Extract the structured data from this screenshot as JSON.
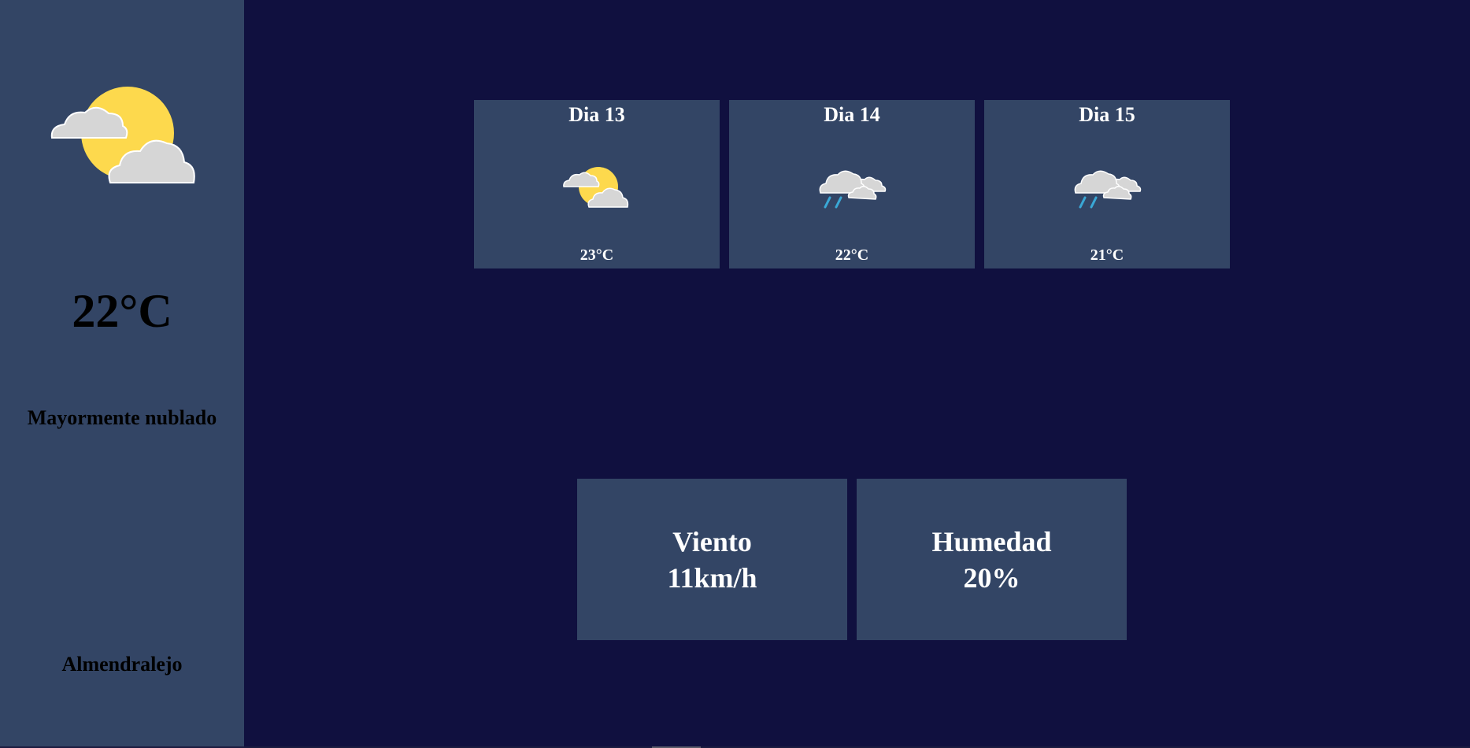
{
  "current": {
    "icon": "sun-behind-clouds-icon",
    "temperature": "22°C",
    "description": "Mayormente nublado",
    "city": "Almendralejo"
  },
  "forecast": [
    {
      "day": "Dia 13",
      "icon": "partly-cloudy-icon",
      "temperature": "23°C"
    },
    {
      "day": "Dia 14",
      "icon": "rain-clouds-icon",
      "temperature": "22°C"
    },
    {
      "day": "Dia 15",
      "icon": "rain-clouds-icon",
      "temperature": "21°C"
    }
  ],
  "stats": {
    "wind_label": "Viento",
    "wind_value": "11km/h",
    "humidity_label": "Humedad",
    "humidity_value": "20%"
  },
  "colors": {
    "background": "#10103f",
    "panel": "#334565",
    "sun": "#fdd94d",
    "cloud": "#d6d6d6",
    "rain": "#3aa8d6"
  }
}
